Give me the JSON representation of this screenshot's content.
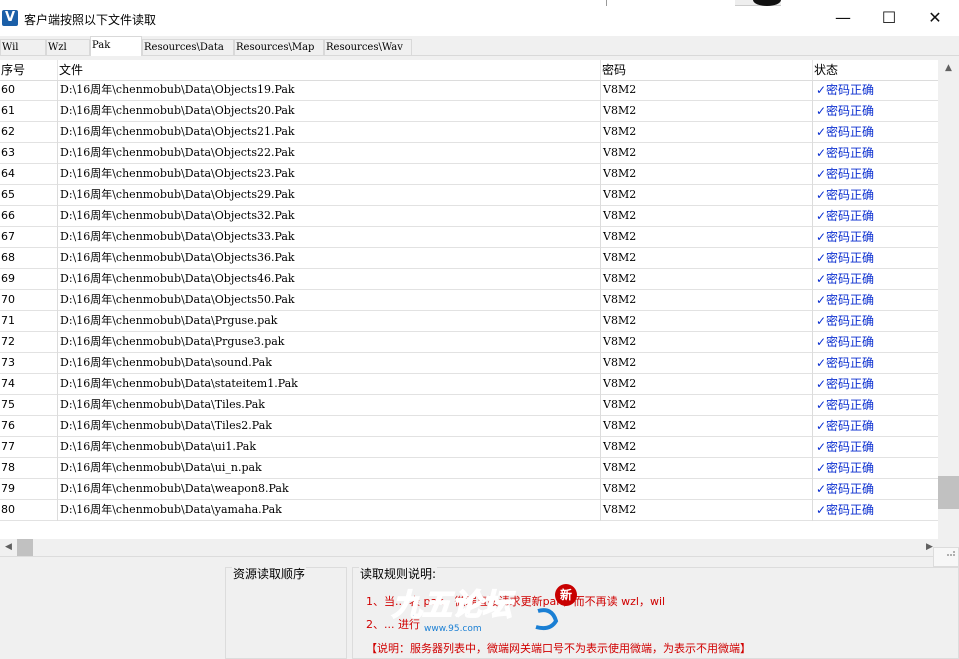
{
  "window": {
    "title": "客户端按照以下文件读取",
    "icon_letter": "V",
    "minimize": "—",
    "maximize": "☐",
    "close": "✕"
  },
  "tabs": [
    {
      "label": "Wil",
      "active": false
    },
    {
      "label": "Wzl",
      "active": false
    },
    {
      "label": "Pak",
      "active": true
    },
    {
      "label": "Resources\\Data",
      "active": false
    },
    {
      "label": "Resources\\Map",
      "active": false
    },
    {
      "label": "Resources\\Wav",
      "active": false
    }
  ],
  "table": {
    "columns": [
      "序号",
      "文件",
      "密码",
      "状态"
    ],
    "rows": [
      {
        "idx": "60",
        "file": "D:\\16周年\\chenmobub\\Data\\Objects19.Pak",
        "pwd": "V8M2",
        "status": "✓密码正确"
      },
      {
        "idx": "61",
        "file": "D:\\16周年\\chenmobub\\Data\\Objects20.Pak",
        "pwd": "V8M2",
        "status": "✓密码正确"
      },
      {
        "idx": "62",
        "file": "D:\\16周年\\chenmobub\\Data\\Objects21.Pak",
        "pwd": "V8M2",
        "status": "✓密码正确"
      },
      {
        "idx": "63",
        "file": "D:\\16周年\\chenmobub\\Data\\Objects22.Pak",
        "pwd": "V8M2",
        "status": "✓密码正确"
      },
      {
        "idx": "64",
        "file": "D:\\16周年\\chenmobub\\Data\\Objects23.Pak",
        "pwd": "V8M2",
        "status": "✓密码正确"
      },
      {
        "idx": "65",
        "file": "D:\\16周年\\chenmobub\\Data\\Objects29.Pak",
        "pwd": "V8M2",
        "status": "✓密码正确"
      },
      {
        "idx": "66",
        "file": "D:\\16周年\\chenmobub\\Data\\Objects32.Pak",
        "pwd": "V8M2",
        "status": "✓密码正确"
      },
      {
        "idx": "67",
        "file": "D:\\16周年\\chenmobub\\Data\\Objects33.Pak",
        "pwd": "V8M2",
        "status": "✓密码正确"
      },
      {
        "idx": "68",
        "file": "D:\\16周年\\chenmobub\\Data\\Objects36.Pak",
        "pwd": "V8M2",
        "status": "✓密码正确"
      },
      {
        "idx": "69",
        "file": "D:\\16周年\\chenmobub\\Data\\Objects46.Pak",
        "pwd": "V8M2",
        "status": "✓密码正确"
      },
      {
        "idx": "70",
        "file": "D:\\16周年\\chenmobub\\Data\\Objects50.Pak",
        "pwd": "V8M2",
        "status": "✓密码正确"
      },
      {
        "idx": "71",
        "file": "D:\\16周年\\chenmobub\\Data\\Prguse.pak",
        "pwd": "V8M2",
        "status": "✓密码正确"
      },
      {
        "idx": "72",
        "file": "D:\\16周年\\chenmobub\\Data\\Prguse3.pak",
        "pwd": "V8M2",
        "status": "✓密码正确"
      },
      {
        "idx": "73",
        "file": "D:\\16周年\\chenmobub\\Data\\sound.Pak",
        "pwd": "V8M2",
        "status": "✓密码正确"
      },
      {
        "idx": "74",
        "file": "D:\\16周年\\chenmobub\\Data\\stateitem1.Pak",
        "pwd": "V8M2",
        "status": "✓密码正确"
      },
      {
        "idx": "75",
        "file": "D:\\16周年\\chenmobub\\Data\\Tiles.Pak",
        "pwd": "V8M2",
        "status": "✓密码正确"
      },
      {
        "idx": "76",
        "file": "D:\\16周年\\chenmobub\\Data\\Tiles2.Pak",
        "pwd": "V8M2",
        "status": "✓密码正确"
      },
      {
        "idx": "77",
        "file": "D:\\16周年\\chenmobub\\Data\\ui1.Pak",
        "pwd": "V8M2",
        "status": "✓密码正确"
      },
      {
        "idx": "78",
        "file": "D:\\16周年\\chenmobub\\Data\\ui_n.pak",
        "pwd": "V8M2",
        "status": "✓密码正确"
      },
      {
        "idx": "79",
        "file": "D:\\16周年\\chenmobub\\Data\\weapon8.Pak",
        "pwd": "V8M2",
        "status": "✓密码正确"
      },
      {
        "idx": "80",
        "file": "D:\\16周年\\chenmobub\\Data\\yamaha.Pak",
        "pwd": "V8M2",
        "status": "✓密码正确"
      }
    ]
  },
  "scrollbars": {
    "up": "▲",
    "left": "◀",
    "right": "▶",
    "vertical_position": 0.93,
    "horizontal_position": 0.0
  },
  "bottom": {
    "order_title": "资源读取顺序",
    "rules_title": "读取规则说明:",
    "rule1": "1、当... 表 pak，微端直接请求更新pak，而不再读 wzl，wil",
    "rule2": "2、... 进行",
    "rule3": "【说明：服务器列表中，微端网关端口号不为表示使用微端，为表示不用微端】",
    "watermark_text": "九五论坛",
    "watermark_url": "www.95.com",
    "watermark_badge": "新"
  },
  "colors": {
    "status": "#0b2fd0",
    "rules": "#d00000",
    "watermark": "#1a7fd4"
  }
}
